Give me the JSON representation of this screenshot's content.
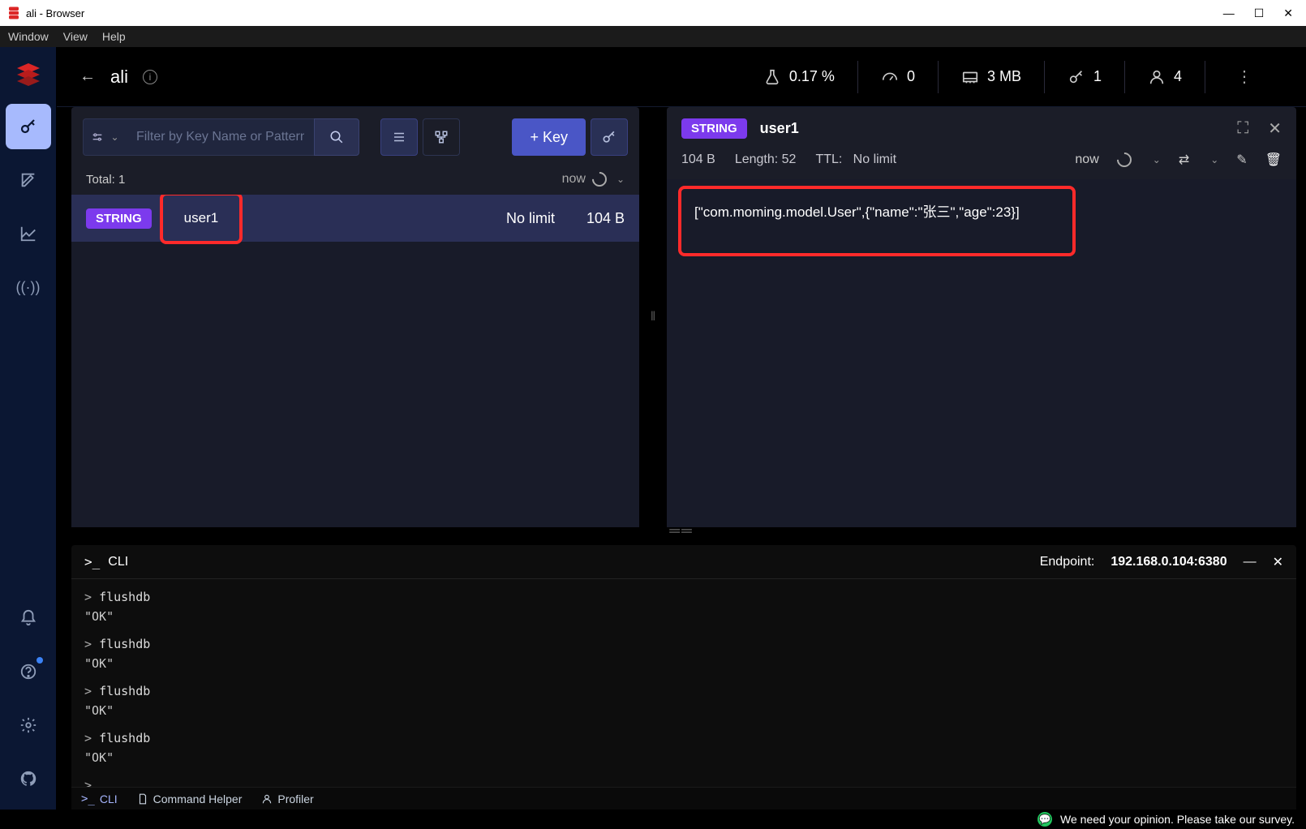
{
  "window": {
    "title": "ali - Browser"
  },
  "menubar": {
    "items": [
      "Window",
      "View",
      "Help"
    ]
  },
  "header": {
    "dbname": "ali",
    "stats": {
      "cpu": "0.17 %",
      "ops": "0",
      "memory": "3 MB",
      "keys": "1",
      "clients": "4"
    }
  },
  "keys_panel": {
    "filter_placeholder": "Filter by Key Name or Pattern",
    "add_key_label": "+ Key",
    "total_label": "Total: 1",
    "refresh_label": "now",
    "rows": [
      {
        "type": "STRING",
        "name": "user1",
        "ttl": "No limit",
        "size": "104 B"
      }
    ]
  },
  "detail": {
    "type_badge": "STRING",
    "keyname": "user1",
    "size": "104 B",
    "length": "Length: 52",
    "ttl_label": "TTL:",
    "ttl_value": "No limit",
    "refresh_label": "now",
    "value": "[\"com.moming.model.User\",{\"name\":\"张三\",\"age\":23}]"
  },
  "cli": {
    "title": "CLI",
    "endpoint_label": "Endpoint:",
    "endpoint": "192.168.0.104:6380",
    "history": [
      {
        "cmd": "flushdb",
        "resp": "\"OK\""
      },
      {
        "cmd": "flushdb",
        "resp": "\"OK\""
      },
      {
        "cmd": "flushdb",
        "resp": "\"OK\""
      },
      {
        "cmd": "flushdb",
        "resp": "\"OK\""
      }
    ],
    "tabs": {
      "cli": "CLI",
      "helper": "Command Helper",
      "profiler": "Profiler"
    }
  },
  "survey": {
    "text": "We need your opinion. Please take our survey."
  }
}
